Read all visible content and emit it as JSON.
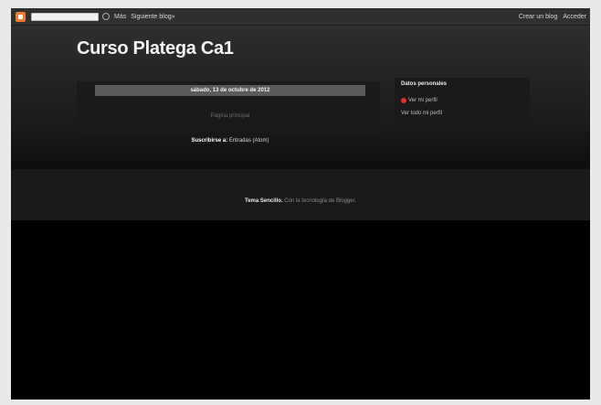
{
  "navbar": {
    "links": [
      "Más",
      "Siguiente blog»"
    ],
    "right_links": [
      "Crear un blog",
      "Acceder"
    ]
  },
  "blog": {
    "title": "Curso Platega Ca1"
  },
  "main": {
    "date_header": "sábado, 13 de octubre de 2012",
    "post_placeholder": "Página principal",
    "subscribe_label": "Suscribirse a:",
    "subscribe_link": "Entradas (Atom)"
  },
  "sidebar": {
    "title": "Datos personales",
    "profile_name": "Ver mi perfil",
    "profile_link": "Ver todo mi perfil"
  },
  "footer": {
    "attribution_prefix": "Tema Sencillo.",
    "attribution_suffix": "Con la tecnología de Blogger."
  },
  "colors": {
    "background": "#000000",
    "accent_logo": "#f07b2b",
    "profile_icon": "#e0301e"
  }
}
